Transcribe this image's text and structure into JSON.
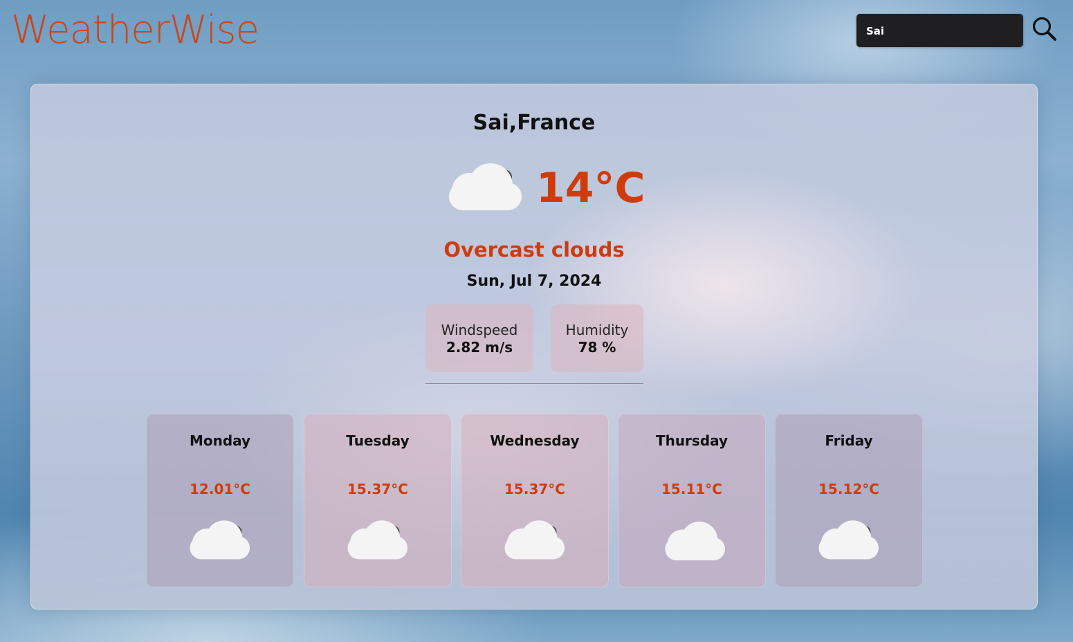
{
  "app": {
    "logo": "WeatherWise"
  },
  "search": {
    "value": "Sai",
    "button_icon": "search-icon"
  },
  "current": {
    "location": "Sai,France",
    "temperature": "14°C",
    "icon": "cloudy-icon",
    "condition": "Overcast clouds",
    "date": "Sun, Jul 7, 2024",
    "windspeed": {
      "label": "Windspeed",
      "value": "2.82 m/s"
    },
    "humidity": {
      "label": "Humidity",
      "value": "78 %"
    }
  },
  "forecast": [
    {
      "day": "Monday",
      "temp": "12.01°C",
      "icon": "cloudy-icon"
    },
    {
      "day": "Tuesday",
      "temp": "15.37°C",
      "icon": "cloudy-icon"
    },
    {
      "day": "Wednesday",
      "temp": "15.37°C",
      "icon": "cloudy-icon"
    },
    {
      "day": "Thursday",
      "temp": "15.11°C",
      "icon": "cloud-icon"
    },
    {
      "day": "Friday",
      "temp": "15.12°C",
      "icon": "cloudy-icon"
    }
  ],
  "colors": {
    "accent": "#d03b0c",
    "logo": "#c9461a",
    "search_bg": "#1f1f22"
  }
}
